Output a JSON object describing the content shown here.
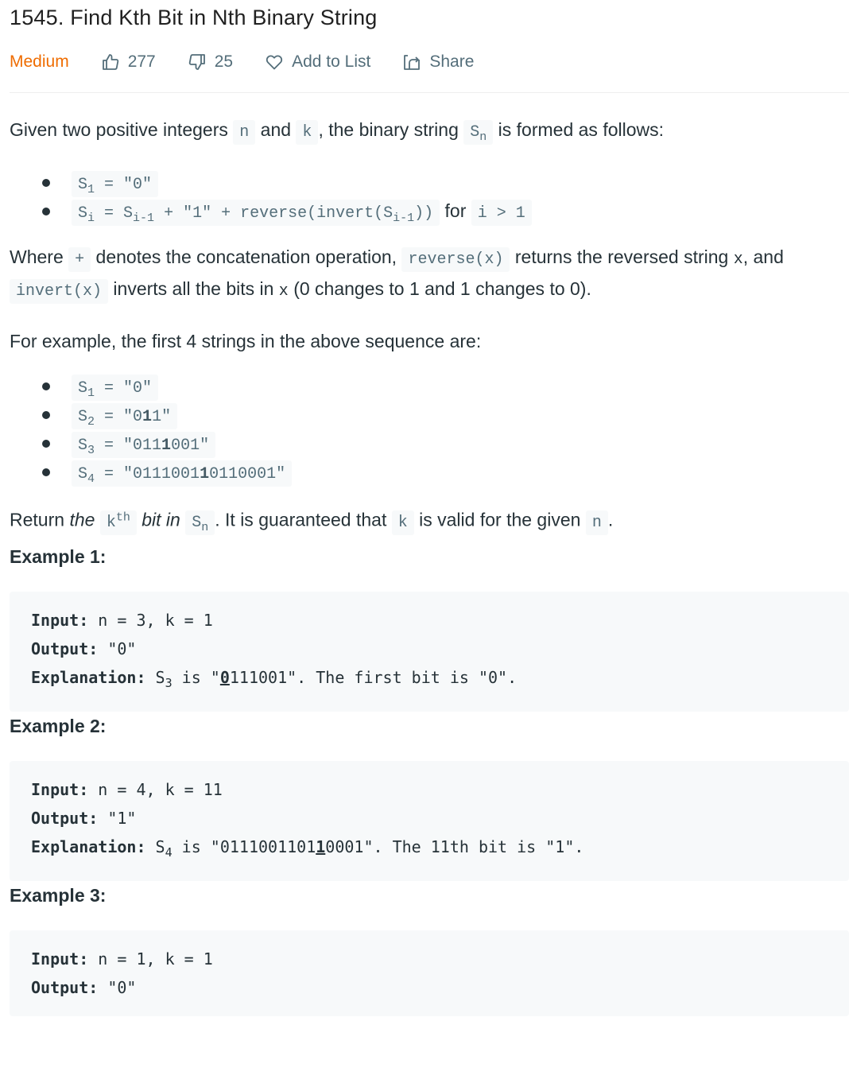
{
  "header": {
    "title": "1545. Find Kth Bit in Nth Binary String",
    "difficulty": "Medium",
    "likes": "277",
    "dislikes": "25",
    "add_to_list": "Add to List",
    "share": "Share",
    "icons": [
      "thumbs-up-icon",
      "thumbs-down-icon",
      "heart-icon",
      "share-icon"
    ],
    "colors": {
      "difficulty": "#ef6c00",
      "meta": "#546e7a"
    }
  },
  "intro": {
    "t1": "Given two positive integers ",
    "n": "n",
    "t2": " and ",
    "k": "k",
    "t3": ", the binary string ",
    "sn_base": "S",
    "sn_sub": "n",
    "t4": " is formed as follows:"
  },
  "rules": {
    "r1_base": "S",
    "r1_sub": "1",
    "r1_rest": " = \"0\"",
    "r2_base": "S",
    "r2_sub": "i",
    "r2_mid": " = S",
    "r2_sub2": "i-1",
    "r2_mid2": " + \"1\" + reverse(invert(S",
    "r2_sub3": "i-1",
    "r2_end": "))",
    "r2_for": " for ",
    "r2_cond": "i > 1"
  },
  "where": {
    "t1": "Where ",
    "plus": "+",
    "t2": " denotes the concatenation operation, ",
    "reverse": "reverse(x)",
    "t3": " returns the reversed string ",
    "x1": "x",
    "t4": ", and ",
    "invert": "invert(x)",
    "t5": " inverts all the bits in ",
    "x2": "x",
    "t6": " (0 changes to 1 and 1 changes to 0)."
  },
  "example_intro": "For example, the first 4 strings in the above sequence are:",
  "sequence": [
    {
      "base": "S",
      "sub": "1",
      "pre": " = \"0",
      "bold": "",
      "post": "\""
    },
    {
      "base": "S",
      "sub": "2",
      "pre": " = \"0",
      "bold": "1",
      "post": "1\""
    },
    {
      "base": "S",
      "sub": "3",
      "pre": " = \"011",
      "bold": "1",
      "post": "001\""
    },
    {
      "base": "S",
      "sub": "4",
      "pre": " = \"0111001",
      "bold": "1",
      "post": "0110001\""
    }
  ],
  "ret": {
    "t1": "Return ",
    "the": "the",
    "k": "k",
    "th": "th",
    "bitin": "bit in",
    "sn_base": "S",
    "sn_sub": "n",
    "t2": ". It is guaranteed that ",
    "k2": "k",
    "t3": " is valid for the given ",
    "n": "n",
    "t4": "."
  },
  "examples": [
    {
      "heading": "Example 1:",
      "input_label": "Input:",
      "input": " n = 3, k = 1",
      "output_label": "Output:",
      "output": " \"0\"",
      "expl_label": "Explanation:",
      "expl_pre": " S",
      "expl_sub": "3",
      "expl_mid": " is \"",
      "expl_u": "0",
      "expl_post": "111001\". The first bit is \"0\"."
    },
    {
      "heading": "Example 2:",
      "input_label": "Input:",
      "input": " n = 4, k = 11",
      "output_label": "Output:",
      "output": " \"1\"",
      "expl_label": "Explanation:",
      "expl_pre": " S",
      "expl_sub": "4",
      "expl_mid": " is \"0111001101",
      "expl_u": "1",
      "expl_post": "0001\". The 11th bit is \"1\"."
    },
    {
      "heading": "Example 3:",
      "input_label": "Input:",
      "input": " n = 1, k = 1",
      "output_label": "Output:",
      "output": " \"0\""
    }
  ]
}
